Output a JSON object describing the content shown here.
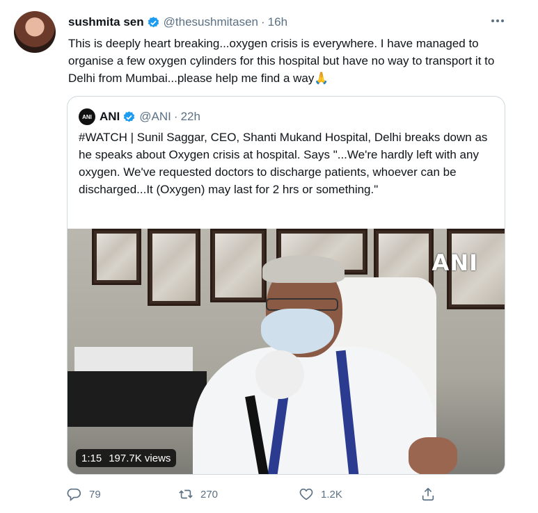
{
  "tweet": {
    "author_name": "sushmita sen",
    "handle": "@thesushmitasen",
    "separator": "·",
    "time": "16h",
    "text": "This is deeply heart breaking...oxygen crisis is everywhere. I have managed to organise a few oxygen cylinders for this hospital but have no way to transport it to Delhi from Mumbai...please help me find a way",
    "emoji": "🙏"
  },
  "quote": {
    "avatar_text": "ANI",
    "author_name": "ANI",
    "handle": "@ANI",
    "separator": "·",
    "time": "22h",
    "text": "#WATCH | Sunil Saggar, CEO, Shanti Mukand Hospital, Delhi breaks down as he speaks about Oxygen crisis at hospital. Says \"...We're hardly left with any oxygen. We've requested doctors to discharge patients, whoever can be discharged...It (Oxygen) may last for 2 hrs or something.\"",
    "video": {
      "watermark": "ANI",
      "duration": "1:15",
      "views": "197.7K views"
    }
  },
  "actions": {
    "reply_count": "79",
    "retweet_count": "270",
    "like_count": "1.2K"
  },
  "icons": {
    "verified": "verified-badge-icon",
    "more": "more-options-icon",
    "reply": "reply-icon",
    "retweet": "retweet-icon",
    "like": "heart-icon",
    "share": "share-icon"
  },
  "colors": {
    "verified": "#1d9bf0",
    "secondary_text": "#5b7083",
    "border": "#cfd9de"
  }
}
